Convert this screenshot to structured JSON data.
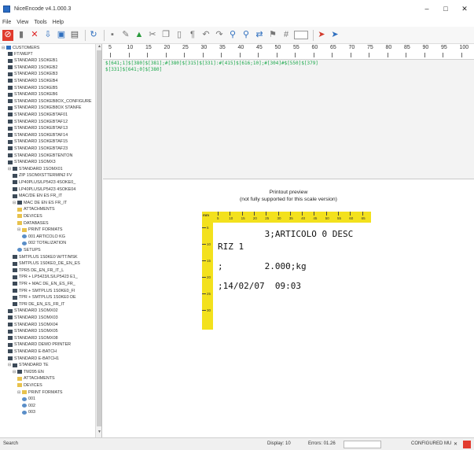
{
  "window": {
    "title": "NiceEncode v4.1.000.3",
    "controls": {
      "minimize": "–",
      "maximize": "□",
      "close": "✕"
    }
  },
  "menu": [
    "File",
    "View",
    "Tools",
    "Help"
  ],
  "toolbar": {
    "icons": [
      "stop-icon",
      "document-icon",
      "delete-icon",
      "import-icon",
      "printer-settings-icon",
      "view-icon",
      "refresh-icon",
      "save-icon",
      "edit-icon",
      "open-icon",
      "cut-icon",
      "copy-icon",
      "paste-icon",
      "paragraph-icon",
      "undo-icon",
      "redo-icon",
      "find-icon",
      "find-next-icon",
      "replace-icon",
      "bookmark-icon",
      "grid-icon"
    ],
    "input_value": "",
    "run_icons": [
      "compile-icon",
      "run-icon"
    ]
  },
  "tree": {
    "root": "CUSTOMERS",
    "items": [
      {
        "label": "FT/WEPT",
        "level": 1,
        "icon": "printer"
      },
      {
        "label": "STANDARD 1SOKEB1",
        "level": 1,
        "icon": "printer"
      },
      {
        "label": "STANDARD 1SOKEB2",
        "level": 1,
        "icon": "printer"
      },
      {
        "label": "STANDARD 1SOKEB3",
        "level": 1,
        "icon": "printer"
      },
      {
        "label": "STANDARD 1SOKEB4",
        "level": 1,
        "icon": "printer"
      },
      {
        "label": "STANDARD 1SOKEB5",
        "level": 1,
        "icon": "printer"
      },
      {
        "label": "STANDARD 1SOKEB6",
        "level": 1,
        "icon": "printer"
      },
      {
        "label": "STANDARD 1SOKEB8OX_CONFIGURE",
        "level": 1,
        "icon": "printer"
      },
      {
        "label": "STANDARD 1SOKEB8OX STANFE",
        "level": 1,
        "icon": "printer"
      },
      {
        "label": "STANDARD 1SOKEBTAF01",
        "level": 1,
        "icon": "printer"
      },
      {
        "label": "STANDARD 1SOKEBTAF12",
        "level": 1,
        "icon": "printer"
      },
      {
        "label": "STANDARD 1SOKEBTAF13",
        "level": 1,
        "icon": "printer"
      },
      {
        "label": "STANDARD 1SOKEBTAF14",
        "level": 1,
        "icon": "printer"
      },
      {
        "label": "STANDARD 1SOKEBTAF15",
        "level": 1,
        "icon": "printer"
      },
      {
        "label": "STANDARD 1SOKEBTAF23",
        "level": 1,
        "icon": "printer"
      },
      {
        "label": "STANDARD 1SOKEBTENTON",
        "level": 1,
        "icon": "printer"
      },
      {
        "label": "STANDARD 1SOMX3",
        "level": 1,
        "icon": "printer"
      },
      {
        "label": "STANDARD 1SOMX01",
        "level": 1,
        "icon": "printer",
        "expanded": true
      },
      {
        "label": "ZIP 1SOMXSTTERMIN2 FV",
        "level": 2,
        "icon": "printer"
      },
      {
        "label": "LP40PLUS/LP5423 4SOKE0_",
        "level": 2,
        "icon": "printer"
      },
      {
        "label": "LP40PLUS/LP5423 4SOKE04",
        "level": 2,
        "icon": "printer"
      },
      {
        "label": "MAC/DE EN ES FR_IT",
        "level": 2,
        "icon": "printer"
      },
      {
        "label": "MAC DE EN ES FR_IT",
        "level": 2,
        "icon": "printer",
        "expanded": true
      },
      {
        "label": "ATTACHMENTS",
        "level": 3,
        "icon": "folder"
      },
      {
        "label": "DEVICES",
        "level": 3,
        "icon": "folder"
      },
      {
        "label": "DATABASES",
        "level": 3,
        "icon": "folder"
      },
      {
        "label": "PRINT FORMATS",
        "level": 3,
        "icon": "folder",
        "expanded": true
      },
      {
        "label": "001 ARTICOLO KG",
        "level": 4,
        "icon": "gear"
      },
      {
        "label": "002 TOTALIZATION",
        "level": 4,
        "icon": "gear"
      },
      {
        "label": "SETUPS",
        "level": 3,
        "icon": "gear"
      },
      {
        "label": "SMTPLUS 1S0KE0 W/TT/MSK",
        "level": 2,
        "icon": "printer"
      },
      {
        "label": "SMTPLUS 1S0KE0_DE_EN_ES",
        "level": 2,
        "icon": "printer"
      },
      {
        "label": "TPR5 DE_EN_FR_IT_L",
        "level": 2,
        "icon": "printer"
      },
      {
        "label": "TPR + LP5423/LS/LP5423 E1_",
        "level": 2,
        "icon": "printer"
      },
      {
        "label": "TPR + MAC DE_EN_ES_FR_",
        "level": 2,
        "icon": "printer"
      },
      {
        "label": "TPR + SMTPLUS 1S0KE0_FI",
        "level": 2,
        "icon": "printer"
      },
      {
        "label": "TPR + SMTPLUS 1S0KE0 DE",
        "level": 2,
        "icon": "printer"
      },
      {
        "label": "TPR DE_EN_ES_FR_IT",
        "level": 2,
        "icon": "printer"
      },
      {
        "label": "STANDARD 1SOMX02",
        "level": 1,
        "icon": "printer"
      },
      {
        "label": "STANDARD 1SOMX03",
        "level": 1,
        "icon": "printer"
      },
      {
        "label": "STANDARD 1SOMX04",
        "level": 1,
        "icon": "printer"
      },
      {
        "label": "STANDARD 1SOMX05",
        "level": 1,
        "icon": "printer"
      },
      {
        "label": "STANDARD 1SOMX08",
        "level": 1,
        "icon": "printer"
      },
      {
        "label": "STANDARD DEMO PRINTER",
        "level": 1,
        "icon": "printer"
      },
      {
        "label": "STANDARD E-BATCH",
        "level": 1,
        "icon": "printer"
      },
      {
        "label": "STANDARD E-BATCH1",
        "level": 1,
        "icon": "printer"
      },
      {
        "label": "STANDARD TE",
        "level": 1,
        "icon": "printer",
        "expanded": true
      },
      {
        "label": "TM295 EN",
        "level": 2,
        "icon": "printer",
        "expanded": true
      },
      {
        "label": "ATTACHMENTS",
        "level": 3,
        "icon": "folder"
      },
      {
        "label": "DEVICES",
        "level": 3,
        "icon": "folder"
      },
      {
        "label": "PRINT FORMATS",
        "level": 3,
        "icon": "folder",
        "expanded": true
      },
      {
        "label": "001",
        "level": 4,
        "icon": "gear"
      },
      {
        "label": "002",
        "level": 4,
        "icon": "gear"
      },
      {
        "label": "003",
        "level": 4,
        "icon": "gear"
      }
    ]
  },
  "editor": {
    "ruler_numbers": [
      "5",
      "10",
      "15",
      "20",
      "25",
      "30",
      "35",
      "40",
      "45",
      "50",
      "55",
      "60",
      "65",
      "70",
      "75",
      "80",
      "85",
      "90",
      "95",
      "100"
    ],
    "lines": [
      "$[641;1]$[380]$[381];#[380]$[315]$[331]:#[415]$[616;10];#[304]#$[550]$[379]",
      "$[331]$[641;0]$[380]"
    ]
  },
  "preview": {
    "title": "Printout preview",
    "subtitle": "(not fully supported for this scale version)",
    "h_ruler_label": "mm",
    "h_ruler_numbers": [
      "5",
      "10",
      "15",
      "20",
      "25",
      "30",
      "35",
      "40",
      "45",
      "50",
      "55",
      "60",
      "65"
    ],
    "v_ruler_numbers": [
      "5",
      "10",
      "15",
      "20",
      "25",
      "30"
    ],
    "lines": [
      "         3;ARTICOLO 0 DESC",
      "RIZ 1",
      ";        2.000;kg",
      ";14/02/07  09:03"
    ]
  },
  "status": {
    "left": "Search",
    "middle1": "Display: 10",
    "middle2": "Errors: 01.26",
    "right": "CONFIGURED MU",
    "close": "✕"
  }
}
